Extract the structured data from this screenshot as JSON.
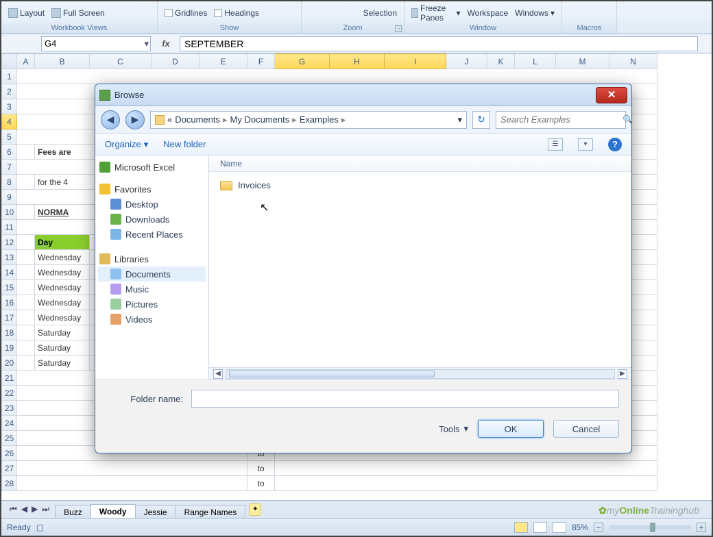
{
  "ribbon": {
    "views": {
      "layout": "Layout",
      "fullscreen": "Full Screen",
      "label": "Workbook Views"
    },
    "show": {
      "gridlines": "Gridlines",
      "headings": "Headings",
      "label": "Show"
    },
    "zoom": {
      "selection": "Selection",
      "label": "Zoom"
    },
    "window": {
      "freeze": "Freeze Panes",
      "workspace": "Workspace",
      "windows": "Windows",
      "label": "Window"
    },
    "macros": {
      "label": "Macros"
    }
  },
  "formula_bar": {
    "name_box": "G4",
    "fx": "fx",
    "value": "SEPTEMBER"
  },
  "grid": {
    "cols": [
      "A",
      "B",
      "C",
      "D",
      "E",
      "F",
      "G",
      "H",
      "I",
      "J",
      "K",
      "L",
      "M",
      "N"
    ],
    "sel_cols": [
      "G",
      "H",
      "I"
    ],
    "sel_row": "4",
    "r6": {
      "B": "Fees are"
    },
    "r8": {
      "B": "for the 4"
    },
    "r10": {
      "B": "NORMA"
    },
    "r12": {
      "B": "Day"
    },
    "r13": {
      "B": "Wednesday"
    },
    "r14": {
      "B": "Wednesday"
    },
    "r15": {
      "B": "Wednesday"
    },
    "r16": {
      "B": "Wednesday"
    },
    "r17": {
      "B": "Wednesday"
    },
    "r18": {
      "B": "Saturday"
    },
    "r19": {
      "B": "Saturday"
    },
    "r20": {
      "B": "Saturday"
    },
    "r26": {
      "F": "to"
    },
    "r27": {
      "F": "to"
    },
    "r28": {
      "F": "to"
    }
  },
  "tabs": {
    "items": [
      "Buzz",
      "Woody",
      "Jessie",
      "Range Names"
    ],
    "active": 1
  },
  "status": {
    "ready": "Ready",
    "zoom": "85%",
    "rec": "▢"
  },
  "watermark": {
    "a": "my",
    "b": "Online",
    "c": "Traininghub"
  },
  "dialog": {
    "title": "Browse",
    "breadcrumb": {
      "a": "«",
      "b": "Documents",
      "c": "My Documents",
      "d": "Examples"
    },
    "search_placeholder": "Search Examples",
    "toolbar": {
      "organize": "Organize",
      "newfolder": "New folder"
    },
    "tree": {
      "excel": "Microsoft Excel",
      "favorites": "Favorites",
      "desktop": "Desktop",
      "downloads": "Downloads",
      "recent": "Recent Places",
      "libraries": "Libraries",
      "documents": "Documents",
      "music": "Music",
      "pictures": "Pictures",
      "videos": "Videos"
    },
    "list": {
      "col_name": "Name",
      "items": [
        "Invoices"
      ]
    },
    "folder_label": "Folder name:",
    "folder_value": "",
    "tools": "Tools",
    "ok": "OK",
    "cancel": "Cancel"
  }
}
